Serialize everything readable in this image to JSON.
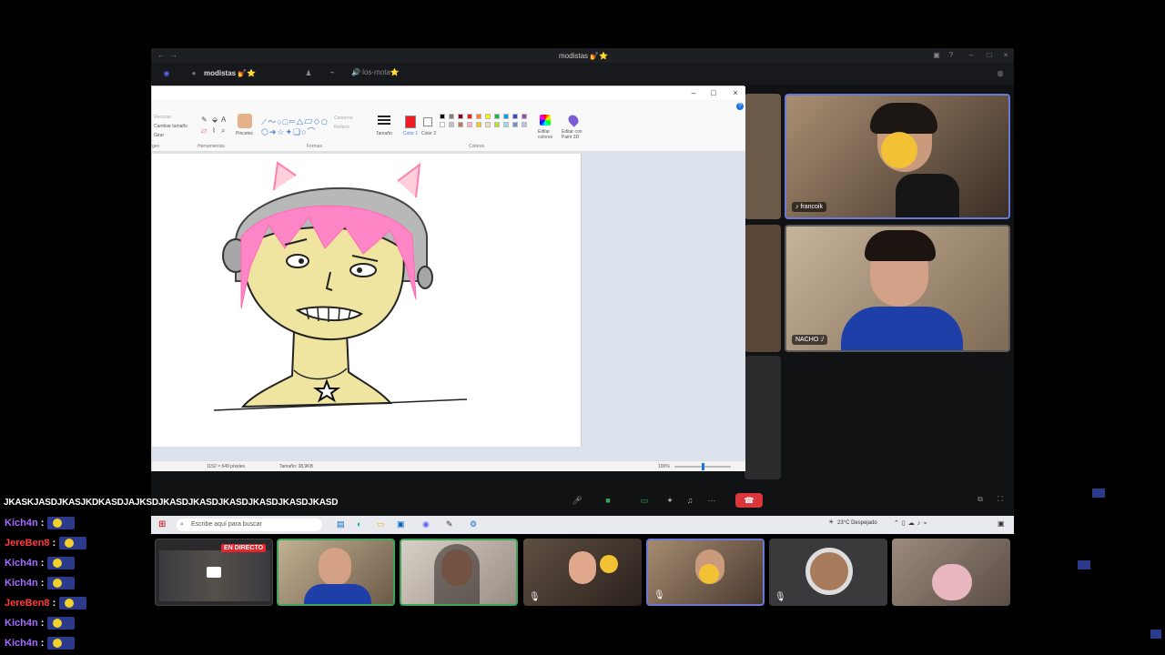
{
  "discord": {
    "window_title": "modistas 💅⭐",
    "server_name": "modistas 💅⭐",
    "channel_name": "🔊 los-mota⭐"
  },
  "paint": {
    "ribbon": {
      "crop": "Recortar",
      "resize": "Cambiar tamaño",
      "rotate": "Girar",
      "group_image": "gen",
      "group_tools": "Herramientas",
      "brushes": "Pinceles",
      "group_shapes": "Formas",
      "outline": "Contorno",
      "fill": "Relleno",
      "size": "Tamaño",
      "color1": "Color 1",
      "color2": "Color 2",
      "group_colors": "Colores",
      "edit_colors": "Editar colores",
      "edit_paint3d": "Editar con Paint 3D"
    },
    "status": {
      "dimensions": "1152 × 649 píxeles",
      "size": "Tamaño: 38,9KB",
      "zoom": "100%"
    },
    "palette": [
      "#000000",
      "#7f7f7f",
      "#880015",
      "#ed1c24",
      "#ff7f27",
      "#fff200",
      "#22b14c",
      "#00a2e8",
      "#3f48cc",
      "#a349a4",
      "#ffffff",
      "#c3c3c3",
      "#b97a57",
      "#ffaec9",
      "#ffc90e",
      "#efe4b0",
      "#b5e61d",
      "#99d9ea",
      "#7092be",
      "#c8bfe7"
    ],
    "color1": "#ed1c24",
    "color2": "#ffffff"
  },
  "participants": [
    {
      "name": "francoik"
    },
    {
      "name": "NACHO :/"
    }
  ],
  "taskbar": {
    "search_placeholder": "Escribe aquí para buscar",
    "weather": "23°C  Despejado"
  },
  "live_badge": "EN DIRECTO",
  "chat": {
    "banner": "JKASKJASDJKASJKDKASDJAJKSDJKASDJKASDJKASDJKASDJKASDJKASD",
    "messages": [
      {
        "user": "Kich4n",
        "color": "#a36bff"
      },
      {
        "user": "JereBen8",
        "color": "#ff3b3b"
      },
      {
        "user": "Kich4n",
        "color": "#a36bff"
      },
      {
        "user": "Kich4n",
        "color": "#a36bff"
      },
      {
        "user": "JereBen8",
        "color": "#ff3b3b"
      },
      {
        "user": "Kich4n",
        "color": "#a36bff"
      },
      {
        "user": "Kich4n",
        "color": "#a36bff"
      }
    ]
  }
}
